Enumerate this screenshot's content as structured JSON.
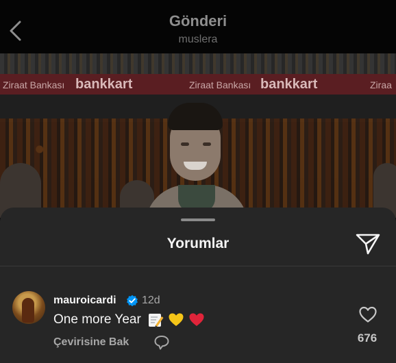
{
  "header": {
    "title": "Gönderi",
    "subtitle": "muslera",
    "back_icon": "chevron-left-icon"
  },
  "photo": {
    "banner_items": [
      "Ziraat Bankası",
      "bankkart",
      "Ziraat Bankası",
      "bankkart",
      "Ziraa"
    ]
  },
  "comments_sheet": {
    "title": "Yorumlar",
    "share_icon": "paper-plane-icon",
    "comment": {
      "username": "mauroicardi",
      "verified": true,
      "time": "12d",
      "text": "One more Year",
      "emojis": [
        "memo-emoji",
        "yellow-heart-emoji",
        "red-heart-emoji"
      ],
      "translate_label": "Çevirisine Bak",
      "like_count": "676"
    }
  },
  "colors": {
    "background": "#000000",
    "sheet": "#262626",
    "verified_blue": "#0095f6",
    "heart_red": "#e0243a",
    "heart_yellow": "#f5c518"
  }
}
